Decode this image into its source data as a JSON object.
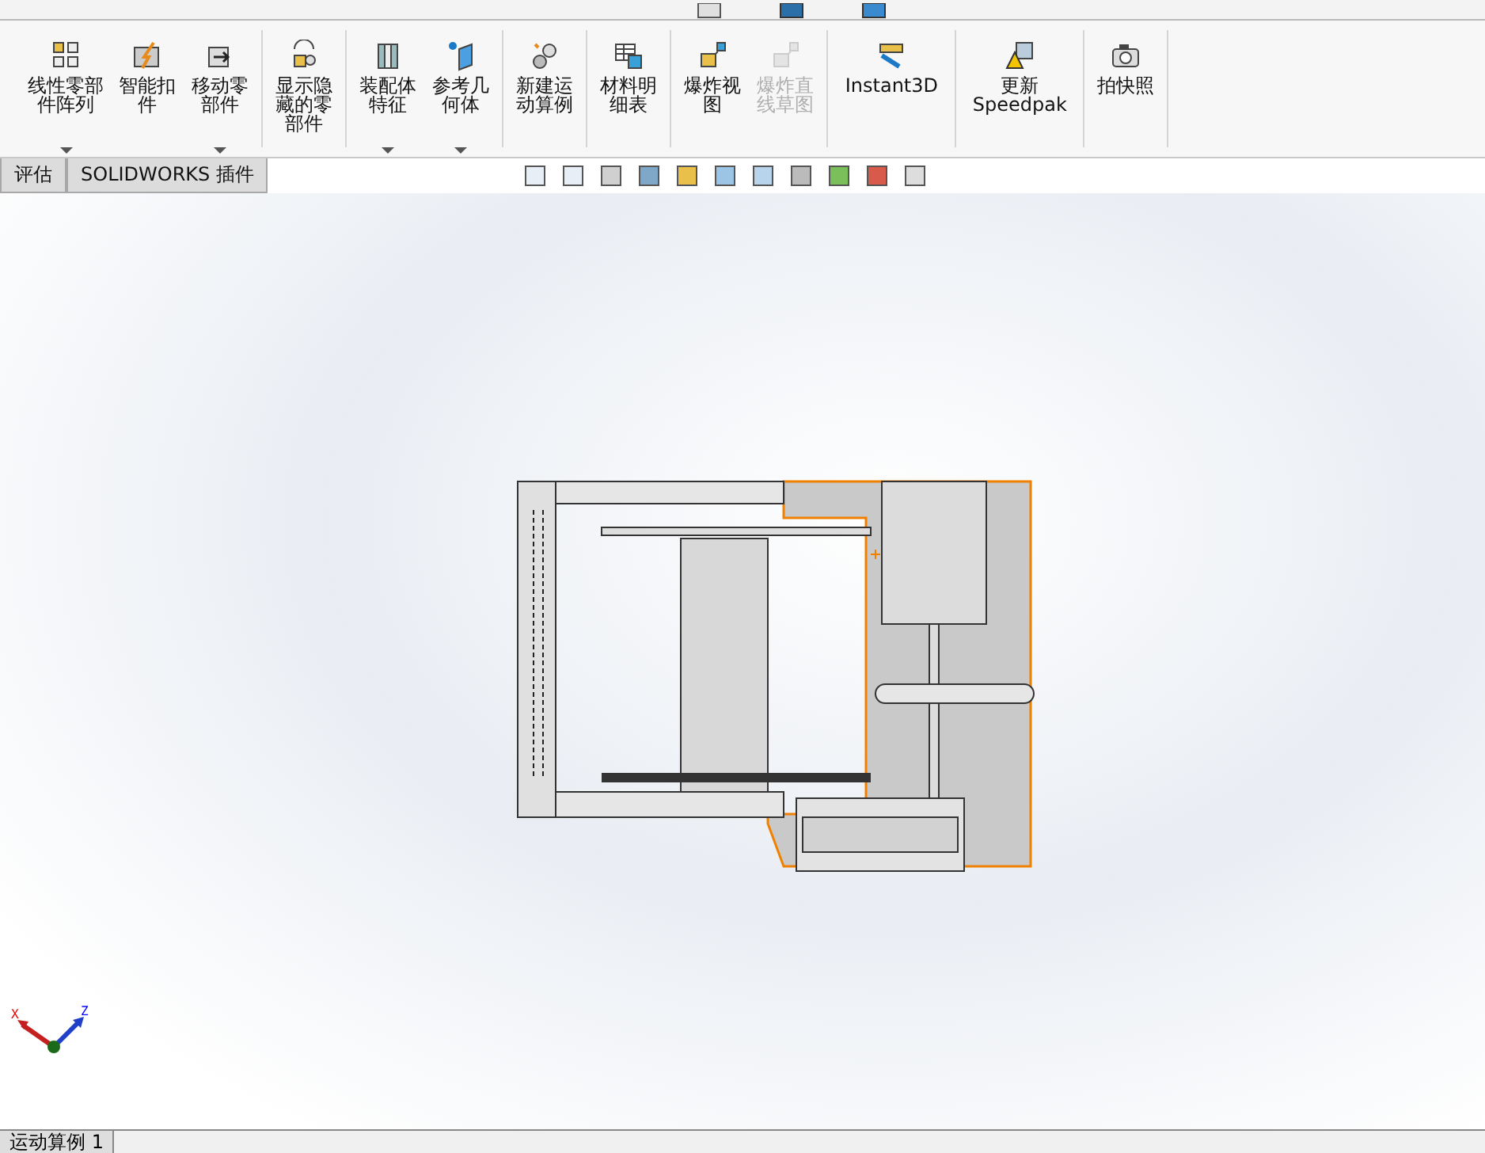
{
  "ribbon": {
    "groups": [
      {
        "buttons": [
          {
            "label": "线性零部件阵列",
            "dropdown": true,
            "disabled": false
          },
          {
            "label": "智能扣件",
            "dropdown": false,
            "disabled": false
          },
          {
            "label": "移动零部件",
            "dropdown": true,
            "disabled": false
          }
        ]
      },
      {
        "buttons": [
          {
            "label": "显示隐藏的零部件",
            "dropdown": false,
            "disabled": false
          }
        ]
      },
      {
        "buttons": [
          {
            "label": "装配体特征",
            "dropdown": true,
            "disabled": false
          },
          {
            "label": "参考几何体",
            "dropdown": true,
            "disabled": false
          }
        ]
      },
      {
        "buttons": [
          {
            "label": "新建运动算例",
            "dropdown": false,
            "disabled": false
          }
        ]
      },
      {
        "buttons": [
          {
            "label": "材料明细表",
            "dropdown": false,
            "disabled": false
          }
        ]
      },
      {
        "buttons": [
          {
            "label": "爆炸视图",
            "dropdown": false,
            "disabled": false
          },
          {
            "label": "爆炸直线草图",
            "dropdown": false,
            "disabled": true
          }
        ]
      },
      {
        "buttons": [
          {
            "label": "Instant3D",
            "dropdown": false,
            "disabled": false
          }
        ]
      },
      {
        "buttons": [
          {
            "label": "更新 Speedpak",
            "dropdown": false,
            "disabled": false
          }
        ]
      },
      {
        "buttons": [
          {
            "label": "拍快照",
            "dropdown": false,
            "disabled": false
          }
        ]
      }
    ]
  },
  "tabs": [
    {
      "label": "评估",
      "selected": false
    },
    {
      "label": "SOLIDWORKS 插件",
      "selected": false
    }
  ],
  "triad": {
    "axes": [
      "X",
      "Z"
    ]
  },
  "bottom_tabs": [
    {
      "label": "运动算例 1",
      "selected": true
    }
  ]
}
